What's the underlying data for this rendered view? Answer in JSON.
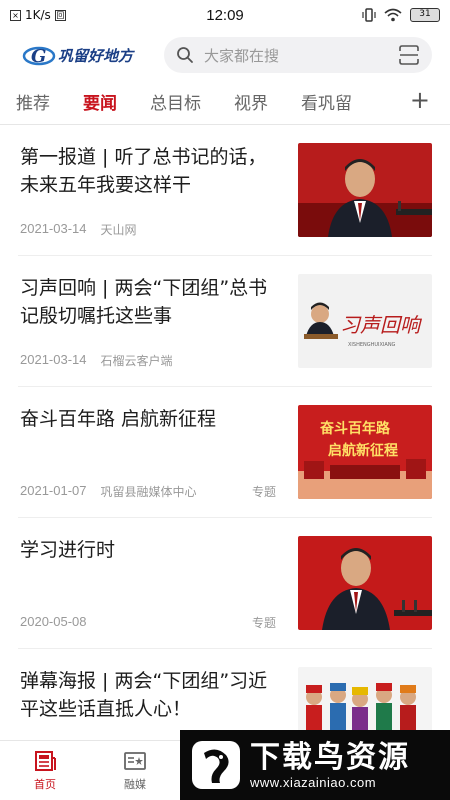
{
  "status_bar": {
    "network_speed": "1K/s",
    "time": "12:09",
    "battery": "31"
  },
  "header": {
    "logo_text": "巩留好地方",
    "search_placeholder": "大家都在搜"
  },
  "tabs": [
    {
      "label": "推荐",
      "active": false
    },
    {
      "label": "要闻",
      "active": true
    },
    {
      "label": "总目标",
      "active": false
    },
    {
      "label": "视界",
      "active": false
    },
    {
      "label": "看巩留",
      "active": false
    }
  ],
  "tabs_more": "+",
  "news": [
    {
      "title": "第一报道 | 听了总书记的话，未来五年我要这样干",
      "date": "2021-03-14",
      "source": "天山网",
      "tag": "",
      "thumb": "portrait-red"
    },
    {
      "title": "习声回响 | 两会“下团组”总书记殷切嘱托这些事",
      "date": "2021-03-14",
      "source": "石榴云客户端",
      "tag": "",
      "thumb": "xi-sheng-huixiang"
    },
    {
      "title": "奋斗百年路 启航新征程",
      "date": "2021-01-07",
      "source": "巩留县融媒体中心",
      "tag": "专题",
      "thumb": "fendou-banner"
    },
    {
      "title": "学习进行时",
      "date": "2020-05-08",
      "source": "",
      "tag": "专题",
      "thumb": "portrait-red-2"
    },
    {
      "title": "弹幕海报 | 两会“下团组”习近平这些话直抵人心！",
      "date": "",
      "source": "",
      "tag": "",
      "thumb": "ethnic-group"
    }
  ],
  "thumb_texts": {
    "banner_line1": "奋斗百年路",
    "banner_line2": "启航新征程",
    "xsh_text": "习声回响",
    "xsh_sub": "XISHENGHUIXIANG"
  },
  "bottom_nav": [
    {
      "label": "首页",
      "active": true,
      "icon": "news-icon"
    },
    {
      "label": "融媒",
      "active": false,
      "icon": "media-card-icon"
    }
  ],
  "watermark": {
    "title": "下载鸟资源",
    "url": "www.xiazainiao.com"
  },
  "colors": {
    "accent": "#c8141e",
    "logo_blue": "#1b3f86"
  }
}
